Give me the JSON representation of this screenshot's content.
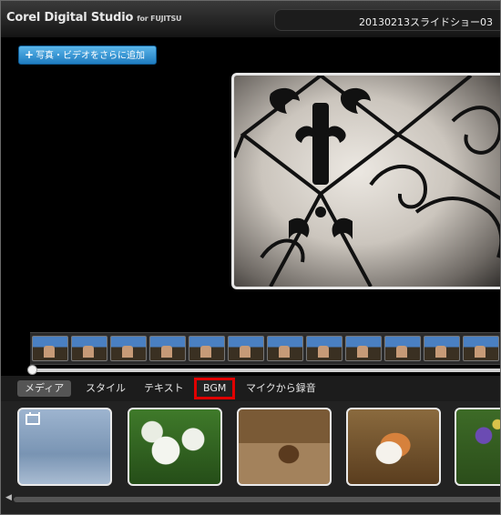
{
  "app": {
    "brand": "Corel Digital Studio",
    "brand_sub": "for FUJITSU",
    "project_title": "20130213スライドショー03"
  },
  "toolbar": {
    "add_media_label": "写真・ビデオをさらに追加"
  },
  "tabs": [
    {
      "label": "メディア",
      "active": true
    },
    {
      "label": "スタイル",
      "active": false
    },
    {
      "label": "テキスト",
      "active": false
    },
    {
      "label": "BGM",
      "active": false,
      "highlighted": true
    },
    {
      "label": "マイクから録音",
      "active": false
    }
  ],
  "icons": {
    "add": "plus-icon",
    "video": "film-icon",
    "scroll_left": "arrow-left-icon"
  },
  "colors": {
    "accent_blue": "#2f8fd4",
    "highlight_red": "#e00000"
  }
}
